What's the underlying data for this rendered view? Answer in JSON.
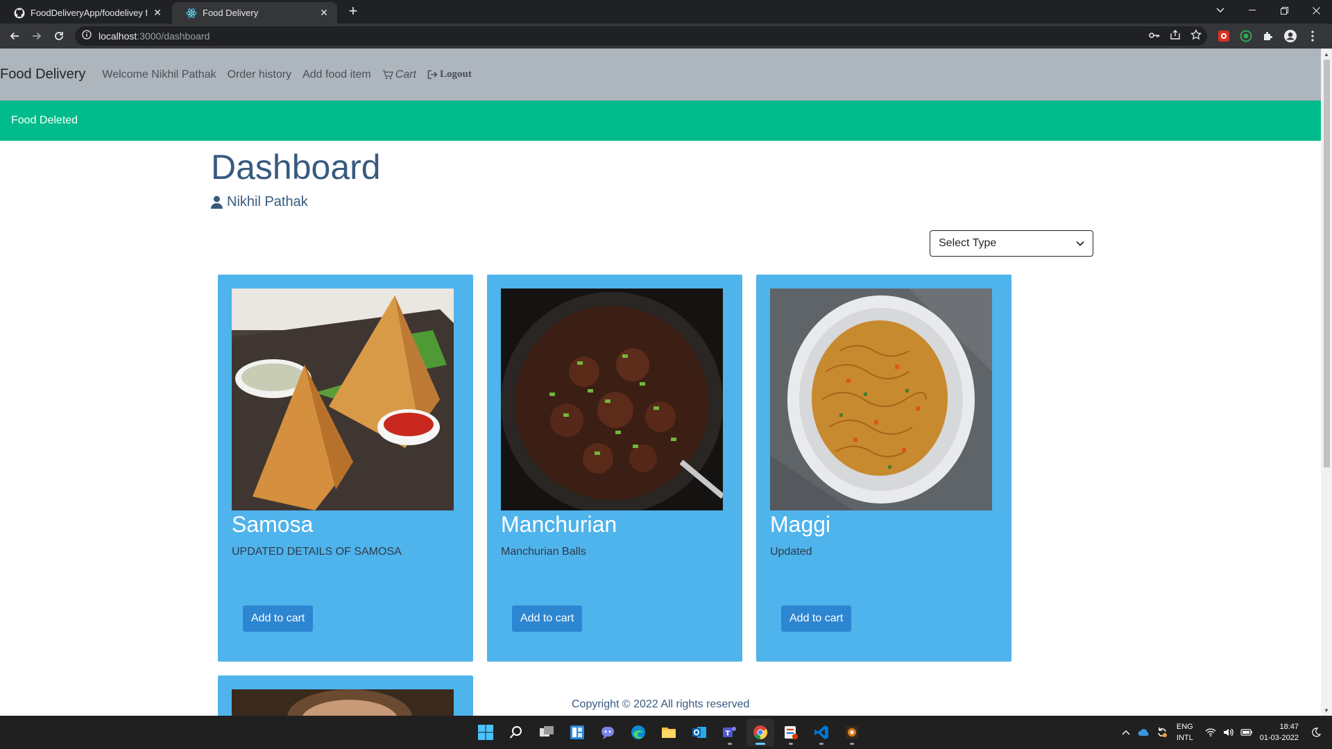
{
  "browser": {
    "tabs": [
      {
        "title": "FoodDeliveryApp/foodelivey fron",
        "icon": "github-icon",
        "active": false
      },
      {
        "title": "Food Delivery",
        "icon": "react-icon",
        "active": true
      }
    ],
    "address": {
      "host": "localhost",
      "path": ":3000/dashboard"
    }
  },
  "navbar": {
    "brand": "Food Delivery",
    "links": {
      "welcome": "Welcome Nikhil Pathak",
      "order_history": "Order history",
      "add_food": "Add food item",
      "cart": "Cart",
      "logout": "Logout"
    }
  },
  "alert": {
    "message": "Food Deleted",
    "color": "#00bc8c"
  },
  "dashboard": {
    "title": "Dashboard",
    "user": "Nikhil Pathak",
    "select": {
      "selected": "Select Type"
    }
  },
  "foods": [
    {
      "name": "Samosa",
      "description": "UPDATED DETAILS OF SAMOSA",
      "button": "Add to cart"
    },
    {
      "name": "Manchurian",
      "description": "Manchurian Balls",
      "button": "Add to cart"
    },
    {
      "name": "Maggi",
      "description": "Updated",
      "button": "Add to cart"
    }
  ],
  "footer": {
    "copyright": "Copyright © 2022 All rights reserved"
  },
  "taskbar": {
    "lang_top": "ENG",
    "lang_bottom": "INTL",
    "time": "18:47",
    "date": "01-03-2022"
  },
  "colors": {
    "card": "#4fb3ec",
    "button": "#2d86d1",
    "heading": "#375a7f",
    "navbar": "#adb5bd"
  }
}
